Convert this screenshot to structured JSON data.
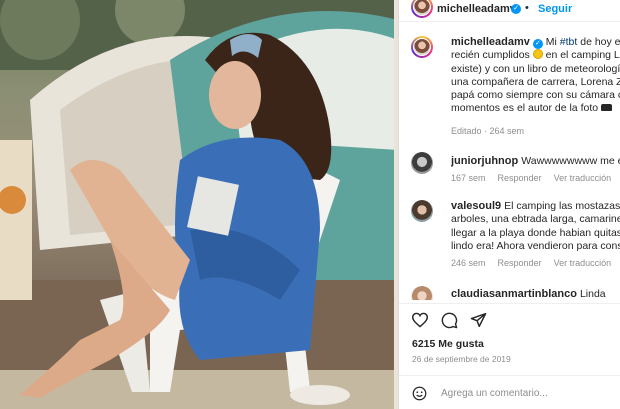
{
  "post": {
    "author": "michelleadamv",
    "follow_label": "Seguir",
    "dot": "•",
    "verified_glyph": "✓"
  },
  "caption": {
    "author": "michelleadamv",
    "line1_pre": "Mi ",
    "hashtag": "#tbt",
    "line1_post": " de hoy es el",
    "line2_pre": "recién cumplidos ",
    "line2_post": " en el camping Las",
    "line3": "existe) y con un libro de meteorología c",
    "line4": "una compañera de carrera, Lorena Zulu",
    "line5": "papá como siempre con su cámara cap",
    "line6": "momentos es el autor de la foto ",
    "meta": "Editado · 264 sem"
  },
  "comments": [
    {
      "author": "juniorjuhnop",
      "lines": [
        "Wawwwwwwww me enar"
      ],
      "time": "167 sem",
      "reply": "Responder",
      "translate": "Ver traducción"
    },
    {
      "author": "valesoul9",
      "lines": [
        "El camping las mostazas era",
        "arboles, una ebtrada larga, camarines y",
        "llegar a la playa donde habian quitasol",
        "lindo era! Ahora vendieron para constru"
      ],
      "time": "246 sem",
      "reply": "Responder",
      "translate": "Ver traducción"
    },
    {
      "author": "claudiasanmartinblanco",
      "lines": [
        "Linda"
      ]
    }
  ],
  "stats": {
    "likes": "6215 Me gusta",
    "date": "26 de septiembre de 2019"
  },
  "composer": {
    "placeholder": "Agrega un comentario..."
  },
  "icons": [
    "heart-icon",
    "comment-icon",
    "share-icon",
    "emoji-icon",
    "verified-icon",
    "sun-emoji",
    "car-emoji"
  ],
  "colors": {
    "accent": "#0095f6",
    "link": "#00376b",
    "muted": "#8e8e8e",
    "text": "#262626"
  }
}
